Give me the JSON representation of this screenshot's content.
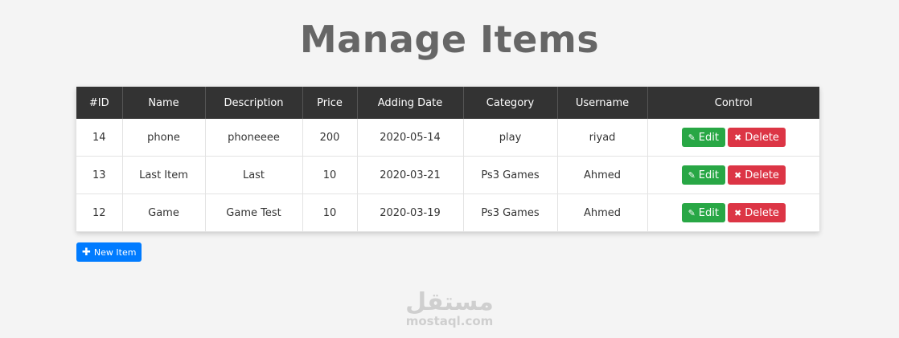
{
  "page": {
    "title": "Manage Items"
  },
  "table": {
    "headers": [
      "#ID",
      "Name",
      "Description",
      "Price",
      "Adding Date",
      "Category",
      "Username",
      "Control"
    ],
    "rows": [
      {
        "id": "14",
        "name": "phone",
        "description": "phoneeee",
        "price": "200",
        "date": "2020-05-14",
        "category": "play",
        "username": "riyad"
      },
      {
        "id": "13",
        "name": "Last Item",
        "description": "Last",
        "price": "10",
        "date": "2020-03-21",
        "category": "Ps3 Games",
        "username": "Ahmed"
      },
      {
        "id": "12",
        "name": "Game",
        "description": "Game Test",
        "price": "10",
        "date": "2020-03-19",
        "category": "Ps3 Games",
        "username": "Ahmed"
      }
    ],
    "edit_label": "Edit",
    "delete_label": "Delete"
  },
  "new_item_label": "New Item",
  "watermark": {
    "logo": "مستقل",
    "text": "mostaql.com"
  },
  "icons": {
    "edit": "edit-icon",
    "delete": "times-icon",
    "add": "plus-icon"
  },
  "colors": {
    "edit": "#28a745",
    "delete": "#dc3545",
    "new": "#007bff",
    "header": "#333333"
  }
}
